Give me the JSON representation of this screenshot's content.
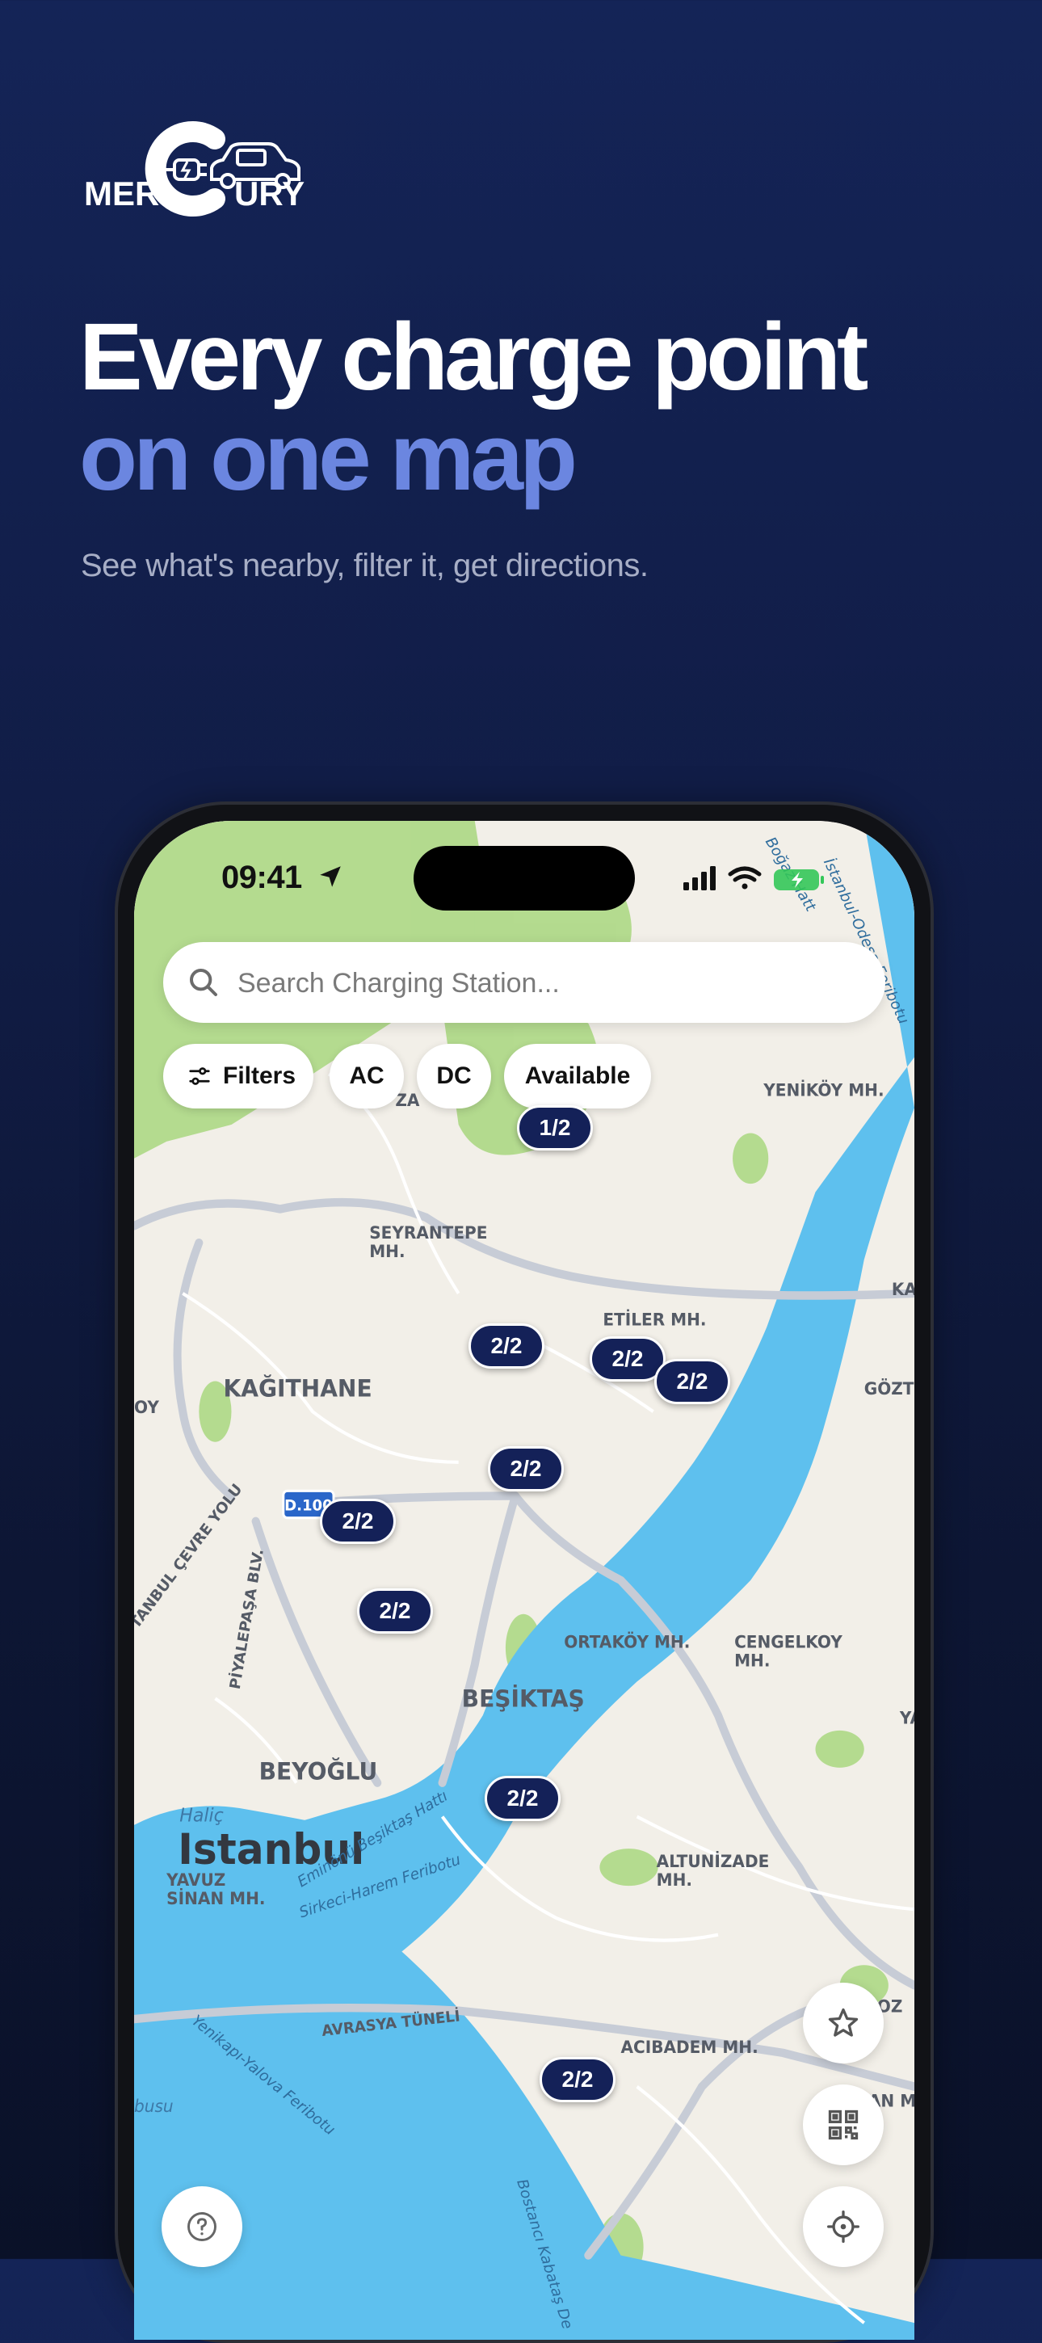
{
  "brand": {
    "logo_text_left": "MER",
    "logo_text_right": "URY"
  },
  "headline": {
    "line1": "Every charge point",
    "line2": "on one map"
  },
  "subtitle": "See what's nearby, filter it, get directions.",
  "colors": {
    "accent": "#6b86e0",
    "pin": "#142158",
    "water": "#5ec0ee",
    "park": "#a9d77f"
  },
  "status_bar": {
    "time": "09:41"
  },
  "search": {
    "placeholder": "Search Charging Station..."
  },
  "filters": {
    "filters_label": "Filters",
    "ac_label": "AC",
    "dc_label": "DC",
    "available_label": "Available"
  },
  "map": {
    "city_label": "Istanbul",
    "road_badge": "D.100",
    "labels": {
      "seyrantepe": "SEYRANTEPE\nMH.",
      "etiler": "ETİLER MH.",
      "kagithane": "KAĞITHANE",
      "ortakoy": "ORTAKÖY MH.",
      "cengelkoy": "CENGELKOY\nMH.",
      "besiktas": "BEŞİKTAŞ",
      "beyoglu": "BEYOĞLU",
      "halic": "Haliç",
      "yavuz_sinan": "YAVUZ\nSİNAN MH.",
      "altunizade": "ALTUNİZADE\nMH.",
      "acibadem": "ACIBADEM MH.",
      "unalan": "ÜNALAN MH",
      "yenikoy": "YENİKÖY MH.",
      "kav": "KAV",
      "gozte": "GÖZTE",
      "oy": "OY",
      "ya": "YA",
      "za": "ZA",
      "oz": "OZ",
      "busu": "busu",
      "cevre_yolu": "TANBUL ÇEVRE YOLU",
      "piyalepasa": "PİYALEPAŞA BLV.",
      "eminonu_ferry": "Eminönü Beşiktaş Hattı",
      "sirkeci_ferry": "Sirkeci-Harem Feribotu",
      "avrasya": "AVRASYA TÜNELİ",
      "yenikapi_ferry": "Yenikapı-Yalova Feribotu",
      "bostanci_ferry": "Bostancı Kabataş De",
      "bogazici_ferry": "Boğaz Hatt",
      "istanbul_odesa": "İstanbul-Odesa Feribotu"
    },
    "pins": [
      {
        "label": "1/2"
      },
      {
        "label": "2/2"
      },
      {
        "label": "2/2"
      },
      {
        "label": "2/2"
      },
      {
        "label": "2/2"
      },
      {
        "label": "2/2"
      },
      {
        "label": "2/2"
      },
      {
        "label": "2/2"
      },
      {
        "label": "2/2"
      }
    ]
  },
  "fabs": [
    "star-icon",
    "qr-code-icon",
    "help-icon",
    "locate-icon"
  ]
}
